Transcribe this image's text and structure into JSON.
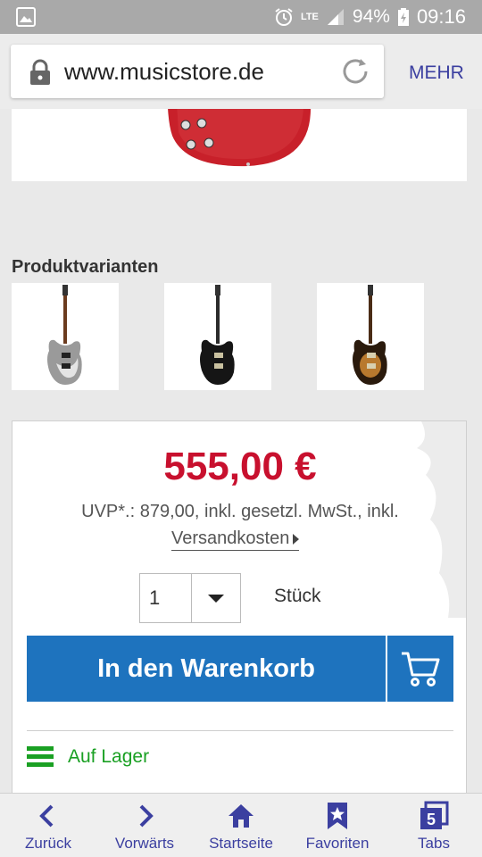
{
  "status_bar": {
    "network": "LTE",
    "battery": "94%",
    "time": "09:16"
  },
  "browser": {
    "url": "www.musicstore.de",
    "menu_label": "MEHR"
  },
  "product_variants": {
    "title": "Produktvarianten",
    "items": [
      {
        "icon": "guitar-silver"
      },
      {
        "icon": "guitar-black"
      },
      {
        "icon": "guitar-sunburst"
      }
    ]
  },
  "buy_box": {
    "price": "555,00 €",
    "uvp": "UVP*.: 879,00,  inkl. gesetzl. MwSt., inkl.",
    "shipping_link": "Versandkosten",
    "quantity": "1",
    "unit": "Stück",
    "add_to_cart": "In den Warenkorb",
    "stock": "Auf Lager"
  },
  "bottom_nav": {
    "items": [
      {
        "label": "Zurück",
        "icon": "chevron-left-icon"
      },
      {
        "label": "Vorwärts",
        "icon": "chevron-right-icon"
      },
      {
        "label": "Startseite",
        "icon": "home-icon"
      },
      {
        "label": "Favoriten",
        "icon": "bookmark-star-icon"
      },
      {
        "label": "Tabs",
        "icon": "tabs-icon",
        "count": "5"
      }
    ]
  },
  "colors": {
    "price_red": "#c8102e",
    "cart_blue": "#1e73be",
    "stock_green": "#1aa023",
    "nav_accent": "#3b3fa0"
  }
}
